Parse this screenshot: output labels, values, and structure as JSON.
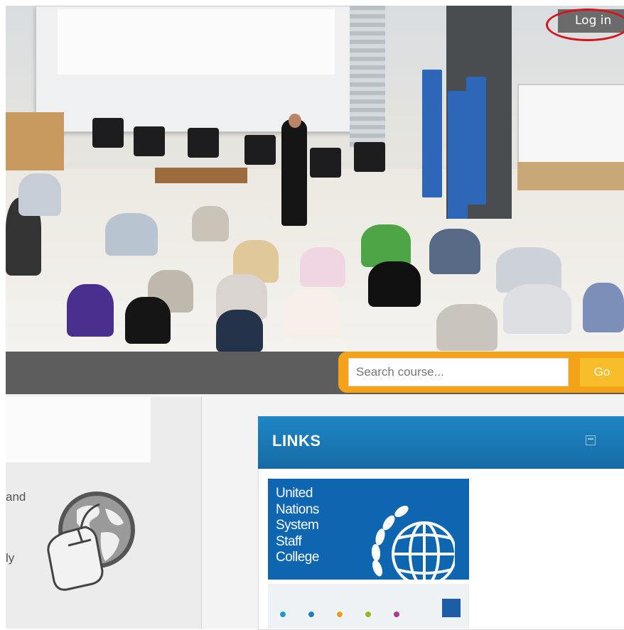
{
  "header": {
    "login_label": "Log in"
  },
  "search": {
    "placeholder": "Search course...",
    "go_label": "Go"
  },
  "left_panel": {
    "fragments": [
      "and",
      "ly"
    ]
  },
  "links_block": {
    "title": "LINKS",
    "logo_lines": [
      "United",
      "Nations",
      "System",
      "Staff",
      "College"
    ]
  },
  "colors": {
    "nav_band": "#5d5d5d",
    "search_frame": "#f4a318",
    "go_button": "#f7bd2a",
    "links_header": "#1f86c6",
    "unssc_blue": "#0f66b0",
    "login_highlight": "#d4141c"
  },
  "icons": {
    "hero": "conference-photo",
    "left": "globe-mouse-icon",
    "collapse": "minimize-icon"
  },
  "dots": [
    "#1a9ad6",
    "#1b7fc4",
    "#f29a1b",
    "#8bbd2a",
    "#b0349c"
  ]
}
